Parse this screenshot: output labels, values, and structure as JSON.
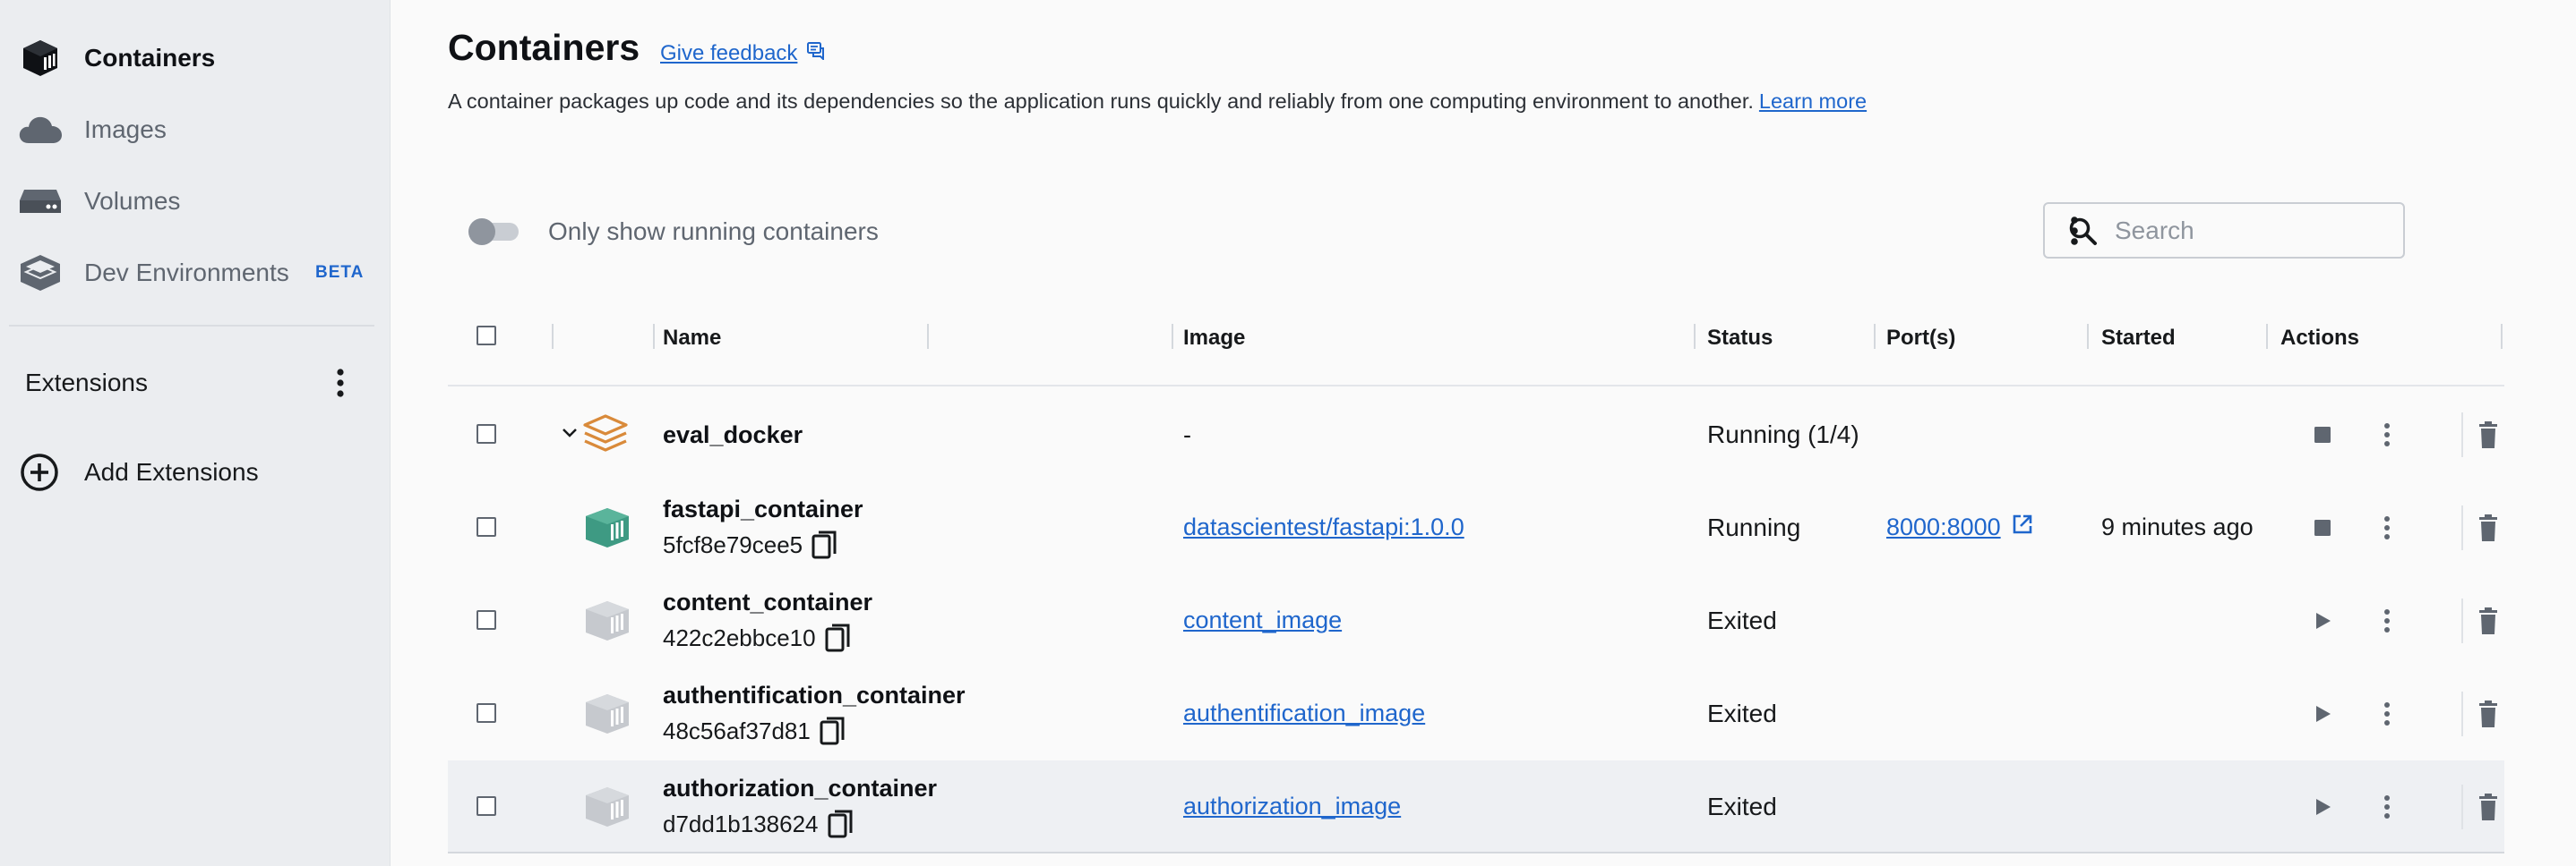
{
  "sidebar": {
    "items": [
      {
        "label": "Containers",
        "icon": "containers-icon",
        "active": true
      },
      {
        "label": "Images",
        "icon": "cloud-icon",
        "active": false
      },
      {
        "label": "Volumes",
        "icon": "volume-drive-icon",
        "active": false
      },
      {
        "label": "Dev Environments",
        "icon": "dev-environments-icon",
        "active": false,
        "badge": "BETA"
      }
    ],
    "extensions_label": "Extensions",
    "add_extensions_label": "Add Extensions"
  },
  "header": {
    "title": "Containers",
    "feedback_label": "Give feedback",
    "description": "A container packages up code and its dependencies so the application runs quickly and reliably from one computing environment to another.",
    "learn_more": "Learn more"
  },
  "filters": {
    "running_only_label": "Only show running containers",
    "running_only_checked": false,
    "search_placeholder": "Search"
  },
  "table": {
    "columns": [
      "Name",
      "Image",
      "Status",
      "Port(s)",
      "Started",
      "Actions"
    ],
    "group": {
      "name": "eval_docker",
      "image": "-",
      "status": "Running (1/4)"
    },
    "rows": [
      {
        "name": "fastapi_container",
        "id": "5fcf8e79cee5",
        "image": "datascientest/fastapi:1.0.0",
        "status": "Running",
        "port": "8000:8000",
        "started": "9 minutes ago",
        "state": "running"
      },
      {
        "name": "content_container",
        "id": "422c2ebbce10",
        "image": "content_image",
        "status": "Exited",
        "port": "",
        "started": "",
        "state": "exited"
      },
      {
        "name": "authentification_container",
        "id": "48c56af37d81",
        "image": "authentification_image",
        "status": "Exited",
        "port": "",
        "started": "",
        "state": "exited"
      },
      {
        "name": "authorization_container",
        "id": "d7dd1b138624",
        "image": "authorization_image",
        "status": "Exited",
        "port": "",
        "started": "",
        "state": "exited"
      }
    ]
  },
  "colors": {
    "accent": "#1f66cc",
    "running_container": "#3e9a83",
    "exited_container": "#c6c9ce",
    "compose_group": "#d98a3a",
    "sidebar_bg": "#ebedf0"
  }
}
